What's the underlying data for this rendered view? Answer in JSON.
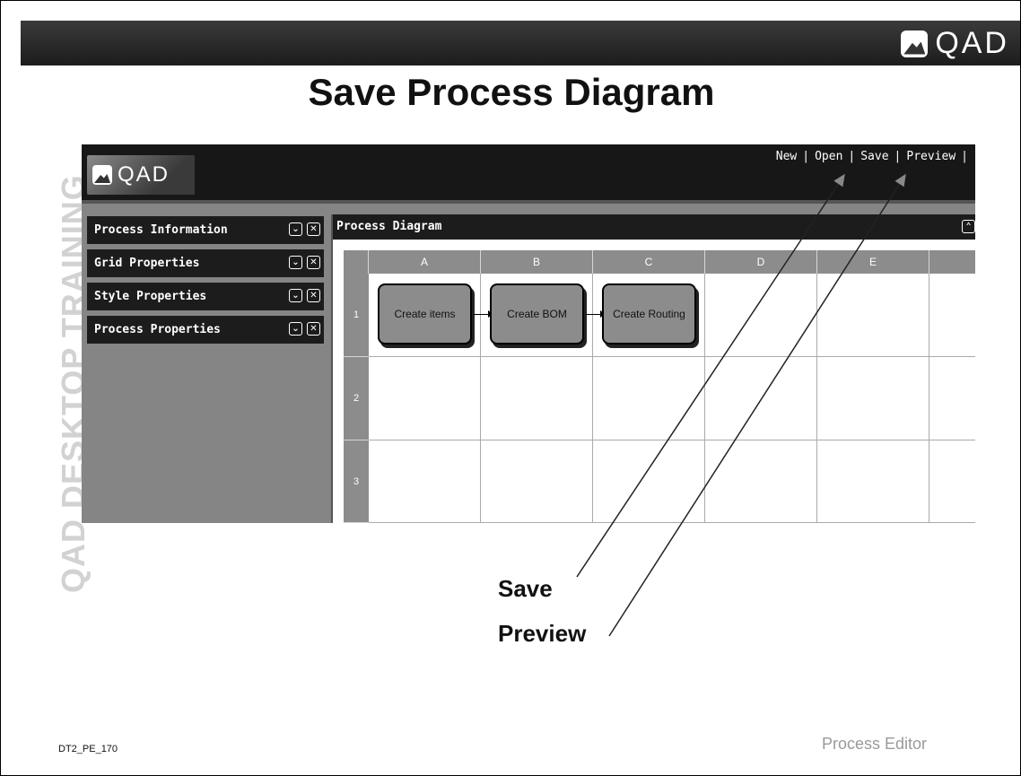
{
  "slide": {
    "brand": "QAD",
    "title": "Save Process Diagram",
    "side_watermark": "QAD DESKTOP TRAINING",
    "footer_code": "DT2_PE_170",
    "footer_section": "Process Editor"
  },
  "app": {
    "brand": "QAD",
    "menu": [
      "New",
      "Open",
      "Save",
      "Preview"
    ],
    "left_panels": [
      {
        "label": "Process Information",
        "expand_icon": "chevron-double-down",
        "close_icon": "close-x"
      },
      {
        "label": "Grid Properties",
        "expand_icon": "chevron-double-down",
        "close_icon": "close-x"
      },
      {
        "label": "Style Properties",
        "expand_icon": "chevron-double-down",
        "close_icon": "close-x"
      },
      {
        "label": "Process Properties",
        "expand_icon": "chevron-double-down",
        "close_icon": "close-x"
      }
    ],
    "diagram": {
      "title": "Process Diagram",
      "collapse_icon": "chevron-double-up",
      "columns": [
        "A",
        "B",
        "C",
        "D",
        "E",
        ""
      ],
      "rows": [
        "1",
        "2",
        "3"
      ],
      "nodes": [
        {
          "label": "Create items",
          "col": "A",
          "row": "1"
        },
        {
          "label": "Create BOM",
          "col": "B",
          "row": "1"
        },
        {
          "label": "Create Routing",
          "col": "C",
          "row": "1"
        }
      ]
    }
  },
  "callouts": {
    "save": "Save",
    "preview": "Preview"
  },
  "colors": {
    "header_dark": "#1c1c1c",
    "panel_gray": "#858585",
    "node_gray": "#8c8c8c",
    "watermark": "#d2d2d2"
  }
}
